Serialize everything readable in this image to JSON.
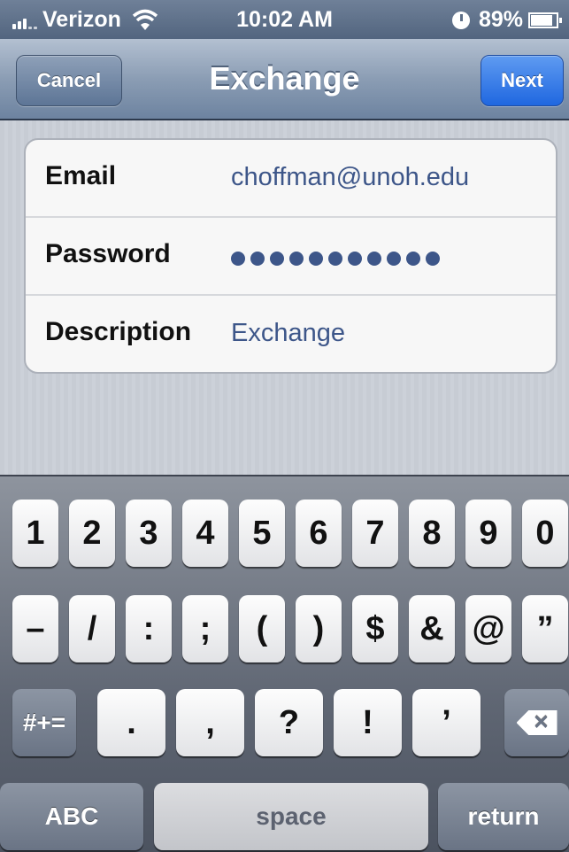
{
  "status_bar": {
    "carrier": "Verizon",
    "time": "10:02 AM",
    "battery": "89%"
  },
  "nav": {
    "cancel": "Cancel",
    "title": "Exchange",
    "next": "Next"
  },
  "form": {
    "email_label": "Email",
    "email_value": "choffman@unoh.edu",
    "password_label": "Password",
    "password_length": 11,
    "description_label": "Description",
    "description_value": "Exchange"
  },
  "keyboard": {
    "row1": [
      "1",
      "2",
      "3",
      "4",
      "5",
      "6",
      "7",
      "8",
      "9",
      "0"
    ],
    "row2": [
      "–",
      "/",
      ":",
      ";",
      "(",
      ")",
      "$",
      "&",
      "@",
      "”"
    ],
    "row3": {
      "shift": "#+=",
      "keys": [
        ".",
        ",",
        "?",
        "!",
        "’"
      ]
    },
    "row4": {
      "abc": "ABC",
      "space": "space",
      "return": "return"
    }
  }
}
